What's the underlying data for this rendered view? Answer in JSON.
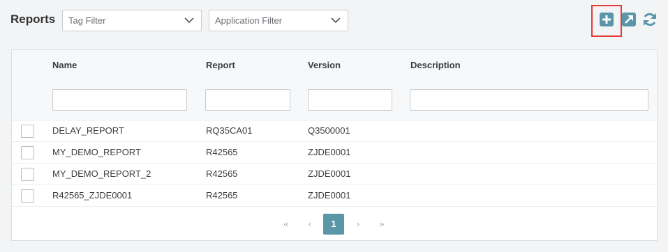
{
  "header": {
    "title": "Reports",
    "tag_filter_placeholder": "Tag Filter",
    "application_filter_placeholder": "Application Filter"
  },
  "toolbar": {
    "icons": [
      "plus-square-icon",
      "external-link-icon",
      "refresh-icon"
    ],
    "accent_color": "#5a96a8",
    "highlight_color": "#e53935"
  },
  "table": {
    "columns": [
      "Name",
      "Report",
      "Version",
      "Description"
    ],
    "rows": [
      {
        "name": "DELAY_REPORT",
        "report": "RQ35CA01",
        "version": "Q3500001",
        "description": ""
      },
      {
        "name": "MY_DEMO_REPORT",
        "report": "R42565",
        "version": "ZJDE0001",
        "description": ""
      },
      {
        "name": "MY_DEMO_REPORT_2",
        "report": "R42565",
        "version": "ZJDE0001",
        "description": ""
      },
      {
        "name": "R42565_ZJDE0001",
        "report": "R42565",
        "version": "ZJDE0001",
        "description": ""
      }
    ]
  },
  "pagination": {
    "first": "«",
    "prev": "‹",
    "current_page": "1",
    "next": "›",
    "last": "»"
  }
}
